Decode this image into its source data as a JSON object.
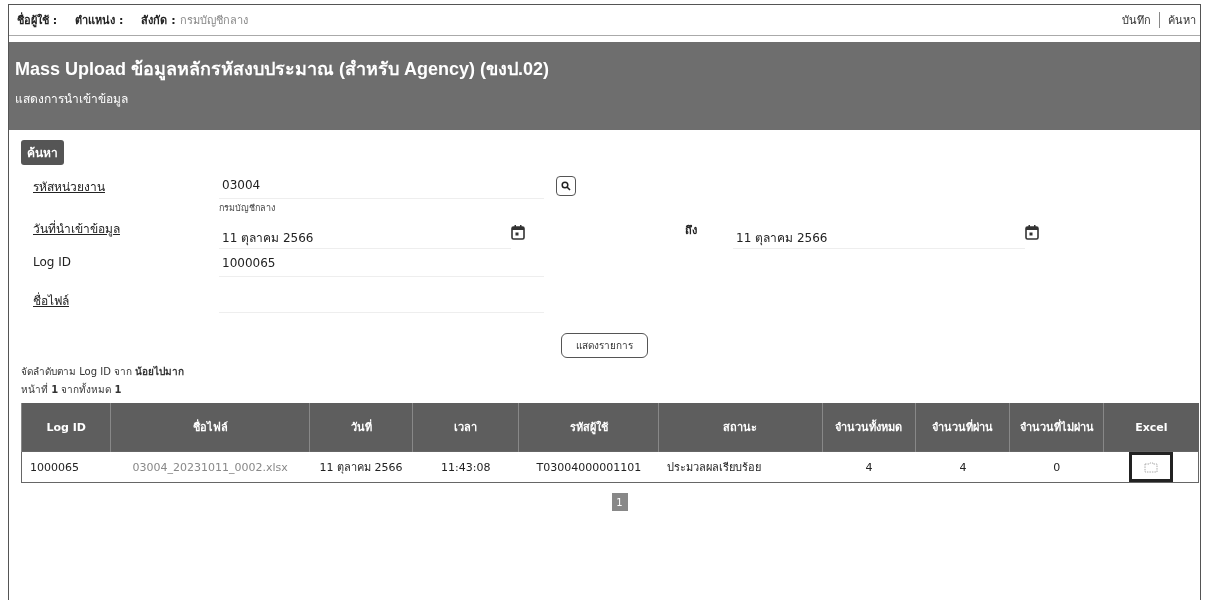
{
  "user_bar": {
    "fields": [
      {
        "label": "ชื่อผู้ใช้ :"
      },
      {
        "label": "ตำแหน่ง :"
      },
      {
        "label": "สังกัด :",
        "value": "กรมบัญชีกลาง"
      }
    ],
    "actions": [
      "บันทึก",
      "ค้นหา"
    ]
  },
  "header": {
    "title": "Mass Upload ข้อมูลหลักรหัสงบประมาณ (สำหรับ Agency) (ขงป.02)",
    "subtitle": "แสดงการนำเข้าข้อมูล"
  },
  "search": {
    "tab": "ค้นหา",
    "unit": {
      "label": "รหัสหน่วยงาน",
      "value": "03004",
      "note": "กรมบัญชีกลาง"
    },
    "date": {
      "label": "วันที่นำเข้าข้อมูล",
      "from": "11 ตุลาคม 2566",
      "to_label": "ถึง",
      "to": "11 ตุลาคม 2566"
    },
    "log_id": {
      "label": "Log ID",
      "value": "1000065"
    },
    "file_name": {
      "label": "ชื่อไฟล์"
    },
    "submit": "แสดงรายการ"
  },
  "sort_note": "จัดลำดับตาม Log ID จาก **น้อยไปมาก**",
  "page_note": "หน้าที่ **1** จากทั้งหมด **1**",
  "table": {
    "columns": [
      "Log ID",
      "ชื่อไฟล์",
      "วันที่",
      "เวลา",
      "รหัสผู้ใช้",
      "สถานะ",
      "จำนวนทั้งหมด",
      "จำนวนที่ผ่าน",
      "จำนวนที่ไม่ผ่าน",
      "Excel"
    ],
    "rows": [
      {
        "cells": [
          "1000065",
          "03004_20231011_0002.xlsx",
          "11 ตุลาคม 2566",
          "11:43:08",
          "T03004000001101",
          "ประมวลผลเรียบร้อย",
          "4",
          "4",
          "0"
        ],
        "excel_selected": true
      }
    ]
  },
  "pagination": [
    {
      "label": "1",
      "selected": true
    }
  ]
}
